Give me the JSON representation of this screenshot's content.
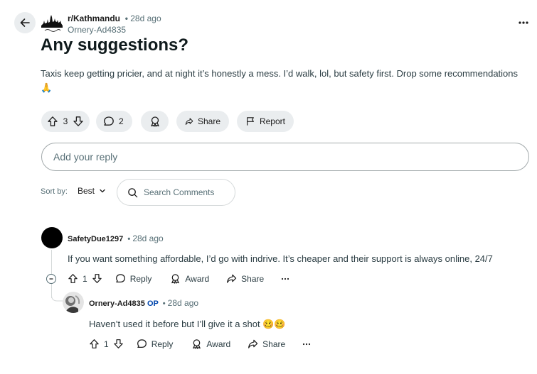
{
  "post": {
    "subreddit": "r/Kathmandu",
    "time": "28d ago",
    "author": "Ornery-Ad4835",
    "title": "Any suggestions?",
    "body": "Taxis keep getting pricier, and at night it’s honestly a mess. I’d walk, lol, but safety first. Drop some recommendations 🙏",
    "score": "3",
    "comment_count": "2",
    "share_label": "Share",
    "report_label": "Report",
    "icons": [
      "back-arrow-icon",
      "more-icon",
      "upvote-icon",
      "downvote-icon",
      "comment-icon",
      "award-icon",
      "share-icon",
      "report-flag-icon"
    ]
  },
  "reply": {
    "placeholder": "Add your reply"
  },
  "sort": {
    "label": "Sort by:",
    "value": "Best",
    "search_placeholder": "Search Comments"
  },
  "comments": [
    {
      "author": "SafetyDue1297",
      "time": "28d ago",
      "text": "If you want something affordable, I’d go with indrive. It’s cheaper and their support is always online, 24/7",
      "score": "1",
      "reply_label": "Reply",
      "award_label": "Award",
      "share_label": "Share",
      "replies": [
        {
          "author": "Ornery-Ad4835",
          "badge": "OP",
          "time": "28d ago",
          "text": "Haven’t used it before but I’ll give it a shot 🥴🥴",
          "score": "1",
          "reply_label": "Reply",
          "award_label": "Award",
          "share_label": "Share"
        }
      ]
    }
  ],
  "colors": {
    "pill_bg": "#eaedef",
    "meta_text": "#576f76",
    "op_badge": "#0045ac"
  }
}
